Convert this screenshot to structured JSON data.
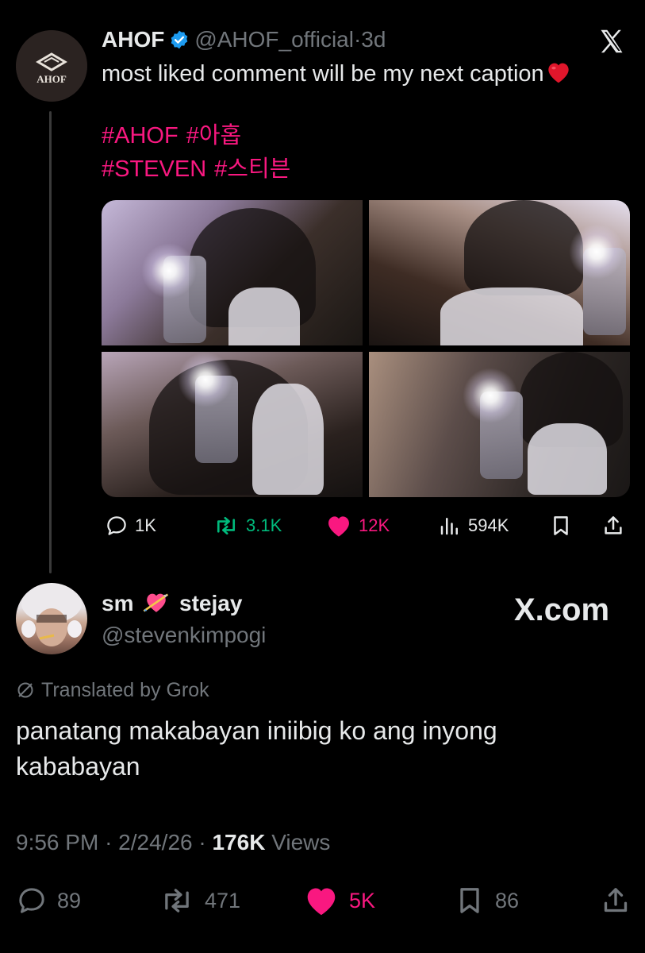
{
  "parent_tweet": {
    "avatar_text": "AHOF",
    "display_name": "AHOF",
    "handle": "@AHOF_official",
    "separator": "·",
    "age": "3d",
    "text": "most liked comment will be my next caption",
    "hashtag_line_1": [
      "#AHOF",
      "#아홉"
    ],
    "hashtag_line_2": [
      "#STEVEN",
      "#스티븐"
    ],
    "actions": {
      "replies": "1K",
      "reposts": "3.1K",
      "likes": "12K",
      "views": "594K"
    }
  },
  "reply_tweet": {
    "display_name_part_1": "sm",
    "display_name_part_2": "stejay",
    "handle": "@stevenkimpogi",
    "translated_label": "Translated by Grok",
    "text": "panatang makabayan iniibig ko ang inyong kababayan",
    "time": "9:56 PM",
    "date": "2/24/26",
    "views_count": "176K",
    "views_label": "Views",
    "actions": {
      "replies": "89",
      "reposts": "471",
      "likes": "5K",
      "bookmarks": "86"
    }
  },
  "watermark": "X.com",
  "colors": {
    "background": "#000000",
    "text": "#e7e9ea",
    "muted": "#71767b",
    "hashtag": "#f91880",
    "like": "#f91880",
    "repost_active": "#00ba7c",
    "verified": "#1d9bf0"
  }
}
